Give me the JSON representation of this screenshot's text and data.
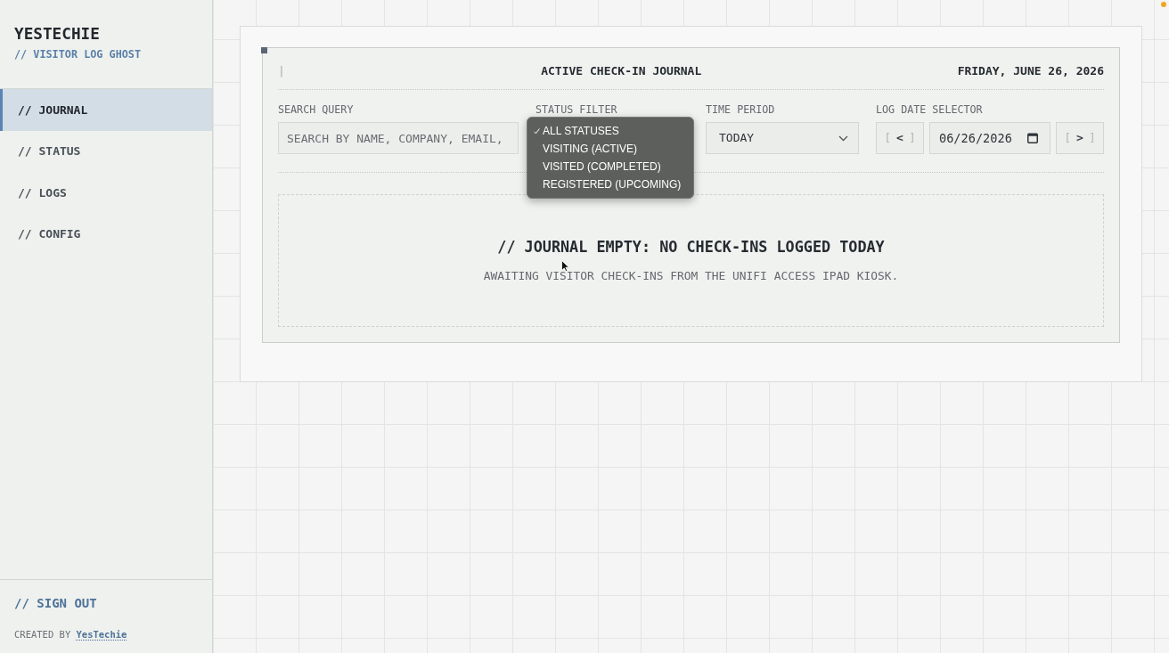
{
  "sidebar": {
    "brand": "YESTECHIE",
    "tagline": "// VISITOR LOG GHOST",
    "nav": [
      {
        "label": "// JOURNAL",
        "selected": true
      },
      {
        "label": "// STATUS",
        "selected": false
      },
      {
        "label": "// LOGS",
        "selected": false
      },
      {
        "label": "// CONFIG",
        "selected": false
      }
    ],
    "sign_out": "// SIGN OUT",
    "credit": {
      "prefix": "CREATED BY",
      "link": "YesTechie"
    }
  },
  "journal": {
    "marker": "|",
    "title": "ACTIVE CHECK-IN JOURNAL",
    "date": "FRIDAY, JUNE 26, 2026",
    "filters": {
      "search": {
        "label": "SEARCH QUERY",
        "placeholder": "SEARCH BY NAME, COMPANY, EMAIL,"
      },
      "status": {
        "label": "STATUS FILTER",
        "expanded": true,
        "options": [
          {
            "label": "ALL STATUSES",
            "selected": true
          },
          {
            "label": "VISITING (ACTIVE)",
            "selected": false
          },
          {
            "label": "VISITED (COMPLETED)",
            "selected": false
          },
          {
            "label": "REGISTERED (UPCOMING)",
            "selected": false
          }
        ]
      },
      "time_period": {
        "label": "TIME PERIOD",
        "value": "TODAY"
      },
      "log_date": {
        "label": "LOG DATE SELECTOR",
        "prev": {
          "open": "[",
          "symbol": "<",
          "close": "]"
        },
        "value": "06/26/2026",
        "next": {
          "open": "[",
          "symbol": ">",
          "close": "]"
        }
      }
    },
    "empty_state": {
      "title": "// JOURNAL EMPTY: NO CHECK-INS LOGGED TODAY",
      "message": "AWAITING VISITOR CHECK-INS FROM THE UNIFI ACCESS IPAD KIOSK."
    }
  }
}
